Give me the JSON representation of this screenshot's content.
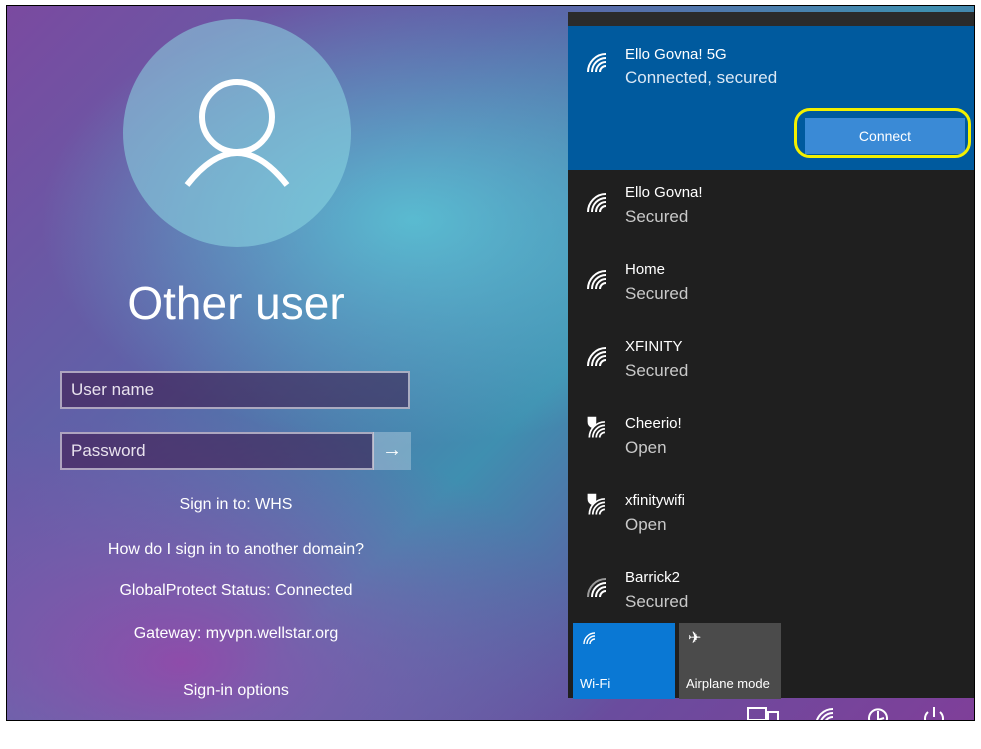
{
  "login": {
    "title": "Other user",
    "username_placeholder": "User name",
    "password_placeholder": "Password",
    "submit_icon": "→",
    "sign_in_to": "Sign in to: WHS",
    "domain_help": "How do I sign in to another domain?",
    "globalprotect_status": "GlobalProtect Status: Connected",
    "gateway": "Gateway: myvpn.wellstar.org",
    "signin_options": "Sign-in options"
  },
  "wifi_panel": {
    "selected": {
      "name": "Ello Govna! 5G",
      "status": "Connected, secured",
      "connect_label": "Connect"
    },
    "networks": [
      {
        "name": "Ello Govna!",
        "status": "Secured",
        "icon": "wifi-icon"
      },
      {
        "name": "Home",
        "status": "Secured",
        "icon": "wifi-icon"
      },
      {
        "name": "XFINITY",
        "status": "Secured",
        "icon": "wifi-icon"
      },
      {
        "name": "Cheerio!",
        "status": "Open",
        "icon": "wifi-open-shield-icon"
      },
      {
        "name": "xfinitywifi",
        "status": "Open",
        "icon": "wifi-open-shield-icon"
      },
      {
        "name": "Barrick2",
        "status": "Secured",
        "icon": "wifi-icon"
      }
    ],
    "tiles": {
      "wifi": "Wi-Fi",
      "airplane": "Airplane mode"
    }
  },
  "taskbar": {
    "icons": [
      "network-icon",
      "wifi-icon",
      "ease-of-access-icon",
      "power-icon"
    ]
  },
  "colors": {
    "accent": "#005a9e",
    "connect_button": "#3a8ad6",
    "highlight": "#f3f000",
    "panel_bg": "#1f1f1f"
  }
}
